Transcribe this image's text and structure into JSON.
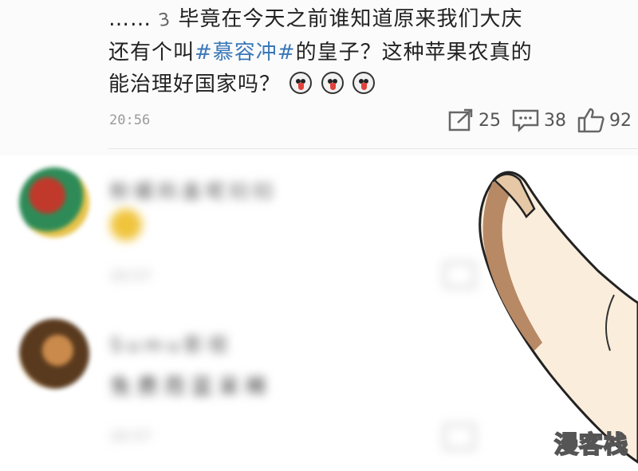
{
  "post": {
    "prefix": "……",
    "sigh_glyph": "3",
    "line1": "毕竟在今天之前谁知道原来我们大庆",
    "line2_before": "还有个叫",
    "hashtag": "#慕容冲#",
    "line2_after": "的皇子？这种苹果农真的",
    "line3": "能治理好国家吗？",
    "emoji_count": 3,
    "time": "20:56",
    "share_count": "25",
    "comment_count": "38",
    "like_count": "92"
  },
  "comments": [
    {
      "name": "粉媚妈盖呢妇妇",
      "body": "",
      "meta": "20:57"
    },
    {
      "name": "Sumu影视",
      "body": "免费而蓝呆稀",
      "meta": "20:57"
    }
  ],
  "watermark": "漫客栈",
  "colors": {
    "hashtag": "#3a78b8",
    "time": "#9a9a9a"
  }
}
